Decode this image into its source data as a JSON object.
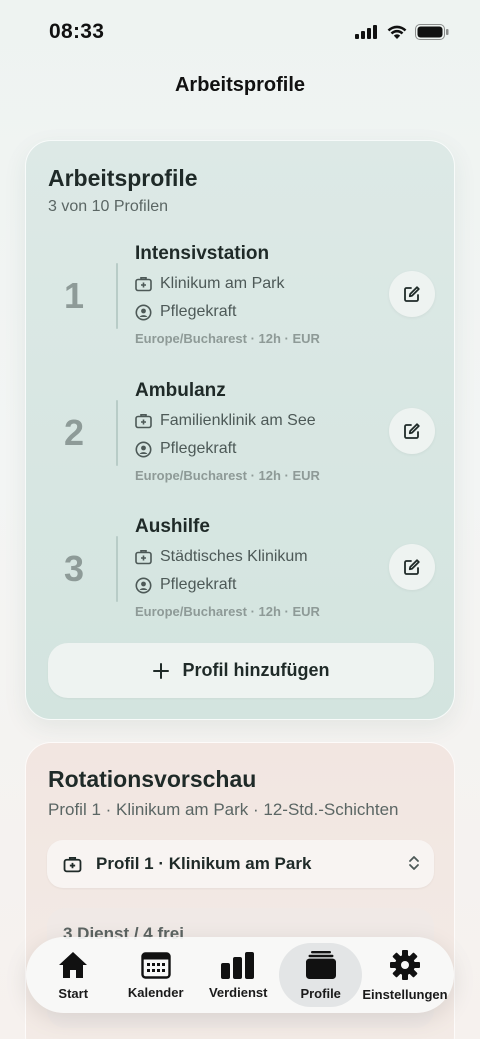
{
  "status_bar": {
    "time": "08:33"
  },
  "nav": {
    "title": "Arbeitsprofile"
  },
  "profiles_card": {
    "title": "Arbeitsprofile",
    "subtitle": "3 von 10 Profilen",
    "profiles": [
      {
        "number": "1",
        "name": "Intensivstation",
        "clinic": "Klinikum am Park",
        "role": "Pflegekraft",
        "meta": "Europe/Bucharest · 12h · EUR"
      },
      {
        "number": "2",
        "name": "Ambulanz",
        "clinic": "Familienklinik am See",
        "role": "Pflegekraft",
        "meta": "Europe/Bucharest · 12h · EUR"
      },
      {
        "number": "3",
        "name": "Aushilfe",
        "clinic": "Städtisches Klinikum",
        "role": "Pflegekraft",
        "meta": "Europe/Bucharest · 12h · EUR"
      }
    ],
    "add_label": "Profil hinzufügen"
  },
  "rotation_card": {
    "title": "Rotationsvorschau",
    "subtitle": "Profil 1 · Klinikum am Park · 12-Std.-Schichten",
    "selected_profile": "Profil 1 · Klinikum am Park",
    "summary": "3 Dienst / 4 frei"
  },
  "tabbar": {
    "tabs": [
      {
        "label": "Start",
        "icon": "home-icon"
      },
      {
        "label": "Kalender",
        "icon": "calendar-icon"
      },
      {
        "label": "Verdienst",
        "icon": "bar-chart-icon"
      },
      {
        "label": "Profile",
        "icon": "stack-icon",
        "active": true
      },
      {
        "label": "Einstellungen",
        "icon": "gear-icon"
      }
    ]
  },
  "colors": {
    "profiles_card_bg": "#d8e7e3",
    "rotation_card_bg": "#f2e7e2",
    "accent_text": "#1f2a28"
  }
}
